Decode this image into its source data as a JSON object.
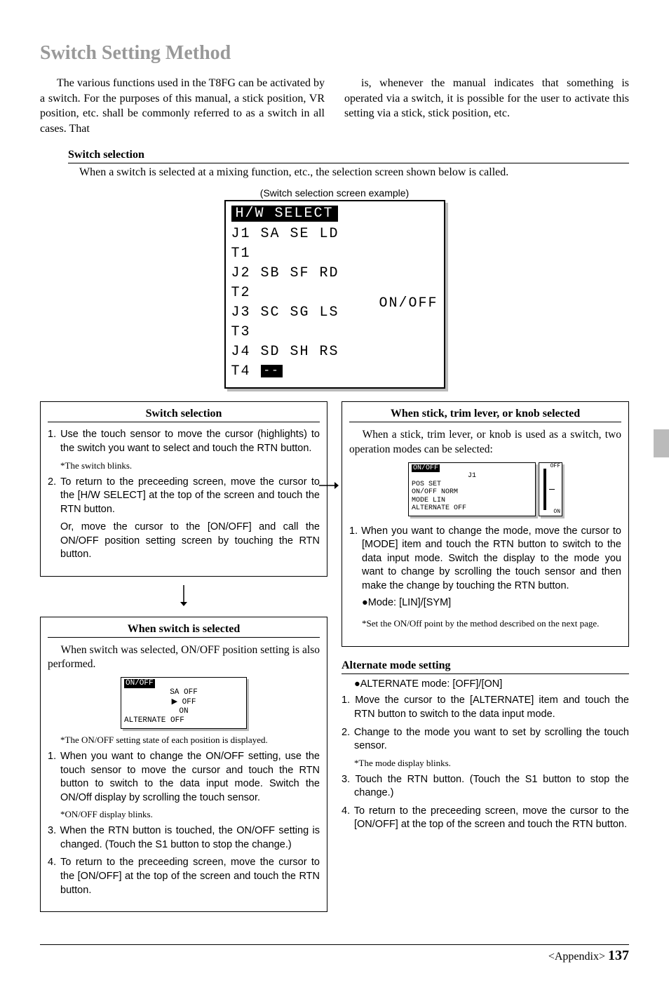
{
  "title": "Switch Setting Method",
  "intro": {
    "left": "The various functions used in the T8FG can be activated by a switch. For the purposes of this manual, a stick position, VR position, etc. shall be commonly referred to as a switch in all cases.  That",
    "right": "is, whenever the manual indicates that something is operated via a switch, it is possible for the user to activate this setting via a stick, stick position, etc."
  },
  "switch_selection": {
    "heading": "Switch selection",
    "line": "When a switch is selected at a mixing function, etc., the selection screen shown below is called."
  },
  "screen_example": {
    "caption": "(Switch selection screen example)",
    "header": "H/W SELECT",
    "rows": [
      "J1 SA SE LD T1",
      "J2 SB SF RD T2",
      "J3 SC SG LS T3",
      "J4 SD SH RS T4"
    ],
    "side": "ON/OFF",
    "dash": "--"
  },
  "left_box1": {
    "title": "Switch selection",
    "step1": "1. Use the touch sensor to move the cursor (highlights) to the switch you want to select and touch the RTN button.",
    "note1": "*The switch blinks.",
    "step2": "2. To return to the preceeding screen, move the cursor to the [H/W SELECT] at the top of the screen and touch the RTN button.",
    "cont": "Or, move the cursor to the [ON/OFF] and call the ON/OFF position setting screen by touching the RTN button."
  },
  "left_box2": {
    "title": "When switch is selected",
    "intro": "When switch was selected, ON/OFF position setting is also performed.",
    "mini": {
      "header": "ON/OFF",
      "line1": "SA    OFF",
      "line2": "    ▶ OFF",
      "line3": "      ON",
      "line4": "ALTERNATE OFF"
    },
    "note1": "*The ON/OFF setting state of each position is displayed.",
    "step1": "1. When you want to change the ON/OFF setting, use the touch sensor to move the cursor and touch the RTN button to switch to the data input mode. Switch the ON/Off display by scrolling the touch sensor.",
    "note2": "*ON/OFF display blinks.",
    "step3": "3. When the RTN button is touched, the ON/OFF setting is changed. (Touch the S1 button to stop the change.)",
    "step4": "4. To return to the preceeding screen, move the cursor to the [ON/OFF] at the top of the screen and touch the RTN button."
  },
  "right_box": {
    "title": "When stick, trim lever, or knob selected",
    "intro": "When a stick, trim lever, or knob is used as a switch, two operation modes can be selected:",
    "mini": {
      "header": "ON/OFF",
      "line1": "      J1",
      "line2": "POS       SET",
      "line3": "ON/OFF    NORM",
      "line4": "MODE      LIN",
      "line5": "ALTERNATE OFF",
      "g_off": "OFF",
      "g_on": "ON"
    },
    "step1": "1. When you want to change the mode, move the cursor to [MODE] item and touch the RTN button to switch to the data input mode. Switch the display to the mode you want to change by scrolling the touch sensor and then make the change by touching the RTN button.",
    "bullet": "●Mode: [LIN]/[SYM]",
    "note": "*Set the ON/Off point by the method described on the next page."
  },
  "alternate": {
    "heading": "Alternate mode setting",
    "bullet": "●ALTERNATE mode: [OFF]/[ON]",
    "step1": "1. Move the cursor to the [ALTERNATE] item and touch the RTN button to switch to the data input mode.",
    "step2": "2. Change to the mode you want to set by scrolling the touch sensor.",
    "note": "*The mode display blinks.",
    "step3": "3. Touch the RTN button. (Touch the S1 button to stop the change.)",
    "step4": "4. To return to the preceeding screen, move the cursor to the [ON/OFF] at the top of the screen and touch the RTN button."
  },
  "footer": {
    "section": "<Appendix>",
    "page": "137"
  }
}
